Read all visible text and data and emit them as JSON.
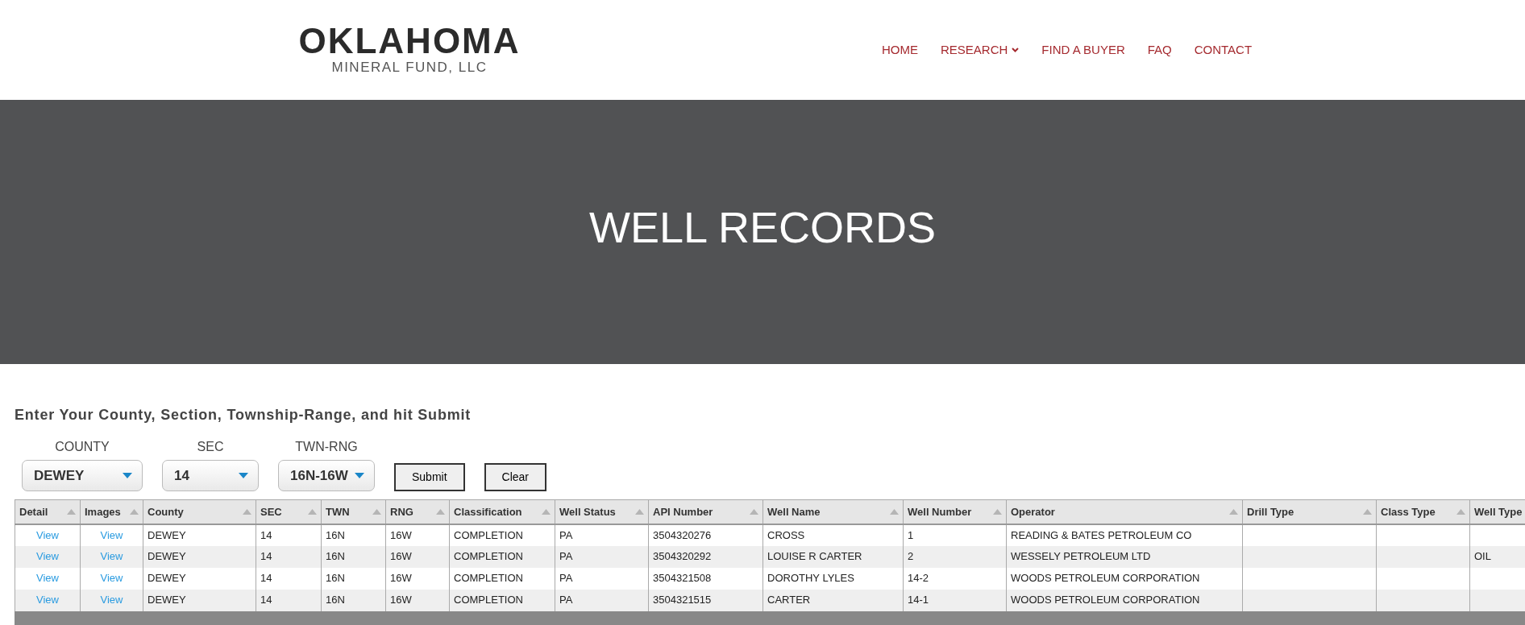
{
  "logo": {
    "title": "OKLAHOMA",
    "subtitle": "MINERAL FUND, LLC"
  },
  "nav": [
    {
      "label": "HOME",
      "dropdown": false
    },
    {
      "label": "RESEARCH",
      "dropdown": true
    },
    {
      "label": "FIND A BUYER",
      "dropdown": false
    },
    {
      "label": "FAQ",
      "dropdown": false
    },
    {
      "label": "CONTACT",
      "dropdown": false
    }
  ],
  "hero": {
    "title": "WELL RECORDS"
  },
  "form": {
    "instructions": "Enter Your County, Section, Township-Range, and hit Submit",
    "selects": [
      {
        "label": "COUNTY",
        "value": "DEWEY"
      },
      {
        "label": "SEC",
        "value": "14"
      },
      {
        "label": "TWN-RNG",
        "value": "16N-16W"
      }
    ],
    "buttons": [
      "Submit",
      "Clear"
    ]
  },
  "table": {
    "columns": [
      {
        "label": "Detail",
        "kind": "link"
      },
      {
        "label": "Images",
        "kind": "link"
      },
      {
        "label": "County",
        "kind": "text"
      },
      {
        "label": "SEC",
        "kind": "text"
      },
      {
        "label": "TWN",
        "kind": "text"
      },
      {
        "label": "RNG",
        "kind": "text"
      },
      {
        "label": "Classification",
        "kind": "text"
      },
      {
        "label": "Well Status",
        "kind": "text"
      },
      {
        "label": "API Number",
        "kind": "text"
      },
      {
        "label": "Well Name",
        "kind": "text"
      },
      {
        "label": "Well Number",
        "kind": "text"
      },
      {
        "label": "Operator",
        "kind": "text"
      },
      {
        "label": "Drill Type",
        "kind": "text"
      },
      {
        "label": "Class Type",
        "kind": "text"
      },
      {
        "label": "Well Type",
        "kind": "text"
      }
    ],
    "rows": [
      [
        "View",
        "View",
        "DEWEY",
        "14",
        "16N",
        "16W",
        "COMPLETION",
        "PA",
        "3504320276",
        "CROSS",
        "1",
        "READING & BATES PETROLEUM CO",
        null,
        null,
        null
      ],
      [
        "View",
        "View",
        "DEWEY",
        "14",
        "16N",
        "16W",
        "COMPLETION",
        "PA",
        "3504320292",
        "LOUISE R CARTER",
        "2",
        "WESSELY PETROLEUM LTD",
        null,
        null,
        "OIL"
      ],
      [
        "View",
        "View",
        "DEWEY",
        "14",
        "16N",
        "16W",
        "COMPLETION",
        "PA",
        "3504321508",
        "DOROTHY LYLES",
        "14-2",
        "WOODS PETROLEUM CORPORATION",
        null,
        null,
        null
      ],
      [
        "View",
        "View",
        "DEWEY",
        "14",
        "16N",
        "16W",
        "COMPLETION",
        "PA",
        "3504321515",
        "CARTER",
        "14-1",
        "WOODS PETROLEUM CORPORATION",
        null,
        null,
        null
      ]
    ]
  }
}
